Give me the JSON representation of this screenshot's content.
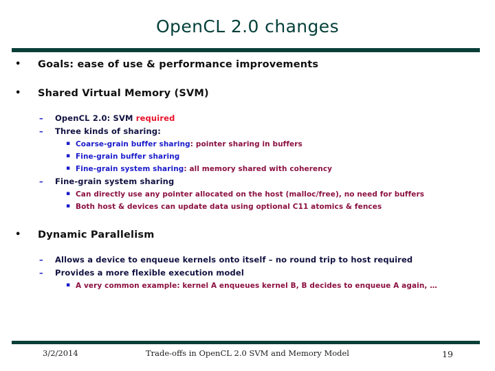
{
  "slide": {
    "title": "OpenCL 2.0 changes",
    "colors": {
      "title": "#06403a",
      "rule": "#0a3f38",
      "level1_text": "#101010",
      "level2_text": "#111140",
      "blue": "#1a1aca",
      "maroon": "#8b1040",
      "red": "#e8122a"
    },
    "bullets": {
      "level1_marker": "•",
      "level2_marker": "–",
      "level3_marker": "▪"
    },
    "content": {
      "goals": "Goals: ease of use & performance improvements",
      "svm_heading": "Shared Virtual Memory (SVM)",
      "svm_required_label": "OpenCL 2.0: SVM ",
      "svm_required_emph": "required",
      "three_kinds": "Three kinds of sharing:",
      "coarse_term": "Coarse-grain buffer sharing",
      "coarse_desc": ": pointer sharing in buffers",
      "fine_buffer": "Fine-grain buffer sharing",
      "fine_system_term": "Fine-grain system sharing",
      "fine_system_desc": ": all memory shared with coherency",
      "fine_grain_system_heading": "Fine-grain system sharing",
      "fgs_point1": "Can directly use any pointer allocated on the host (malloc/free), no need for buffers",
      "fgs_point2": "Both host & devices can update data using optional C11 atomics & fences",
      "dynpar_heading": "Dynamic Parallelism",
      "dynpar_point1": "Allows a device to enqueue kernels onto itself – no round trip to host required",
      "dynpar_point2": "Provides a more flexible execution model",
      "dynpar_sub1": "A very common example: kernel A enqueues kernel B, B decides to enqueue A again, …"
    },
    "footer": {
      "date": "3/2/2014",
      "center": "Trade-offs in OpenCL 2.0 SVM and Memory Model",
      "page": "19"
    }
  }
}
